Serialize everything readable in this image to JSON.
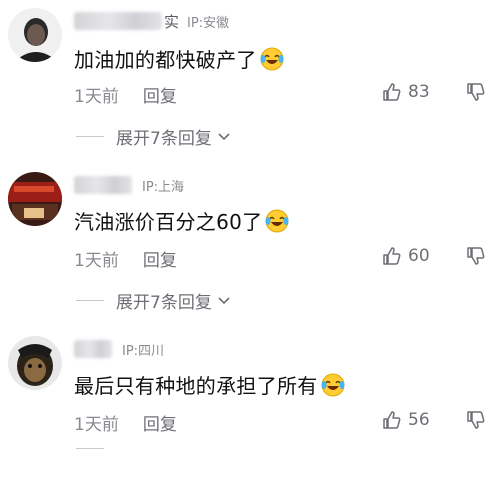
{
  "comments": [
    {
      "name_visible": "实",
      "ip": "IP:安徽",
      "text": "加油加的都快破产了",
      "time": "1天前",
      "reply_label": "回复",
      "likes": "83",
      "expand_label": "展开7条回复"
    },
    {
      "name_visible": "",
      "ip": "IP:上海",
      "text": "汽油涨价百分之60了",
      "time": "1天前",
      "reply_label": "回复",
      "likes": "60",
      "expand_label": "展开7条回复"
    },
    {
      "name_visible": "",
      "ip": "IP:四川",
      "text": "最后只有种地的承担了所有",
      "time": "1天前",
      "reply_label": "回复",
      "likes": "56",
      "expand_label": ""
    }
  ],
  "icons": {
    "emoji": "laughing-crying-emoji",
    "like": "thumbs-up-icon",
    "dislike": "thumbs-down-icon",
    "expand": "chevron-down-icon"
  }
}
